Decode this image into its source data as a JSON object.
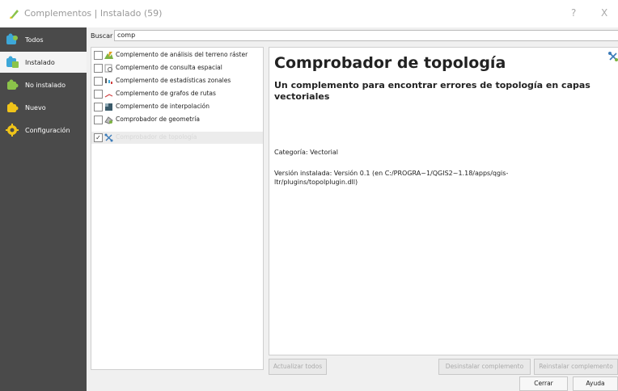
{
  "window": {
    "title": "Complementos | Instalado (59)",
    "help_glyph": "?",
    "close_glyph": "X"
  },
  "sidebar": {
    "items": [
      {
        "label": "Todos",
        "icon": "puzzle-all-icon",
        "active": false
      },
      {
        "label": "Instalado",
        "icon": "puzzle-installed-icon",
        "active": true
      },
      {
        "label": "No instalado",
        "icon": "puzzle-not-installed-icon",
        "active": false
      },
      {
        "label": "Nuevo",
        "icon": "puzzle-new-icon",
        "active": false
      },
      {
        "label": "Configuración",
        "icon": "gear-icon",
        "active": false
      }
    ]
  },
  "search": {
    "label": "Buscar",
    "value": "comp"
  },
  "plugins": [
    {
      "name": "Complemento de análisis del terreno ráster",
      "checked": false,
      "icon": "terrain-icon"
    },
    {
      "name": "Complemento de consulta espacial",
      "checked": false,
      "icon": "query-icon"
    },
    {
      "name": "Complemento de estadísticas zonales",
      "checked": false,
      "icon": "stats-icon"
    },
    {
      "name": "Complemento de grafos de rutas",
      "checked": false,
      "icon": "route-icon"
    },
    {
      "name": "Complemento de interpolación",
      "checked": false,
      "icon": "interpolation-icon"
    },
    {
      "name": "Comprobador de geometría",
      "checked": false,
      "icon": "geometry-icon"
    },
    {
      "name": "Comprobador de topología",
      "checked": true,
      "icon": "topology-icon",
      "selected": true
    }
  ],
  "detail": {
    "title": "Comprobador de topología",
    "description": "Un complemento para encontrar errores de topología en capas vectoriales",
    "category": "Categoría: Vectorial",
    "version": "Versión instalada: Versión 0.1 (en C:/PROGRA~1/QGIS2~1.18/apps/qgis-ltr/plugins/topolplugin.dll)"
  },
  "buttons": {
    "update_all": "Actualizar todos",
    "uninstall": "Desinstalar complemento",
    "reinstall": "Reinstalar complemento",
    "close": "Cerrar",
    "help": "Ayuda"
  },
  "colors": {
    "sidebar_bg": "#4a4a4a",
    "qgis_green": "#8bc34a",
    "qgis_yellow": "#f0c419"
  }
}
